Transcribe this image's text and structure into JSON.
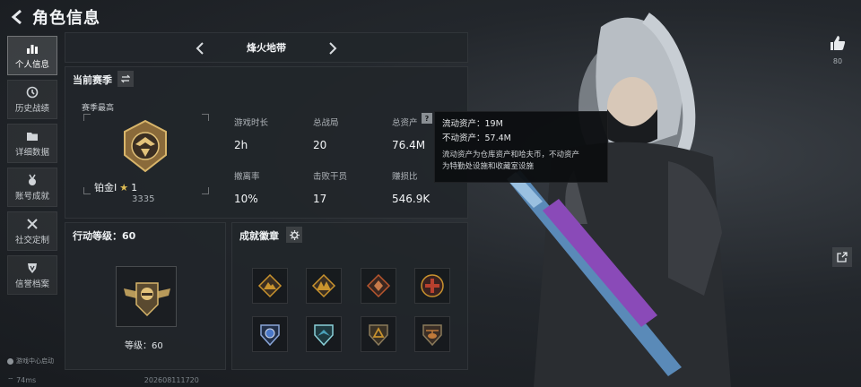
{
  "header": {
    "title": "角色信息"
  },
  "sidebar": {
    "items": [
      {
        "label": "个人信息",
        "icon": "bar-chart-icon",
        "active": true
      },
      {
        "label": "历史战绩",
        "icon": "history-icon",
        "active": false
      },
      {
        "label": "详细数据",
        "icon": "folder-icon",
        "active": false
      },
      {
        "label": "账号成就",
        "icon": "medal-icon",
        "active": false
      },
      {
        "label": "社交定制",
        "icon": "tools-icon",
        "active": false
      },
      {
        "label": "信誉档案",
        "icon": "shield-icon",
        "active": false
      }
    ],
    "game_center": "游戏中心启动"
  },
  "status": {
    "ping": "74ms",
    "uid": "202608111720"
  },
  "map_switcher": {
    "current": "烽火地带"
  },
  "season": {
    "title": "当前赛季",
    "best_label": "赛季最高",
    "rank_name": "铂金Ⅰ",
    "rank_stars": "1",
    "rank_score": "3335",
    "stats": [
      {
        "label": "游戏时长",
        "value": "2h"
      },
      {
        "label": "总战局",
        "value": "20"
      },
      {
        "label": "总资产",
        "value": "76.4M"
      },
      {
        "label": "撤离率",
        "value": "10%"
      },
      {
        "label": "击败干员",
        "value": "17"
      },
      {
        "label": "赚损比",
        "value": "546.9K"
      }
    ]
  },
  "tooltip": {
    "liquid": "流动资产：19M",
    "fixed": "不动资产：57.4M",
    "desc_line1": "流动资产为仓库资产和哈夫币，不动资产",
    "desc_line2": "为特勤处设施和收藏室设施"
  },
  "level": {
    "title": "行动等级：60",
    "level_text": "等级：60"
  },
  "achievements": {
    "title": "成就徽章",
    "badges": [
      {
        "icon": "mountain-badge-icon",
        "color": "#c9932e"
      },
      {
        "icon": "peaks-badge-icon",
        "color": "#c9932e"
      },
      {
        "icon": "diamond-badge-icon",
        "color": "#b8562e"
      },
      {
        "icon": "cross-badge-icon",
        "color": "#b8402e"
      },
      {
        "icon": "police-shield-badge-icon",
        "color": "#4a78c8"
      },
      {
        "icon": "wing-shield-badge-icon",
        "color": "#4aa0b8"
      },
      {
        "icon": "triangle-badge-icon",
        "color": "#c9932e"
      },
      {
        "icon": "helicopter-badge-icon",
        "color": "#c07a3a"
      }
    ]
  },
  "like": {
    "count": "80"
  },
  "colors": {
    "accent_gold": "#c9a24a",
    "panel_bg": "#22262a"
  }
}
